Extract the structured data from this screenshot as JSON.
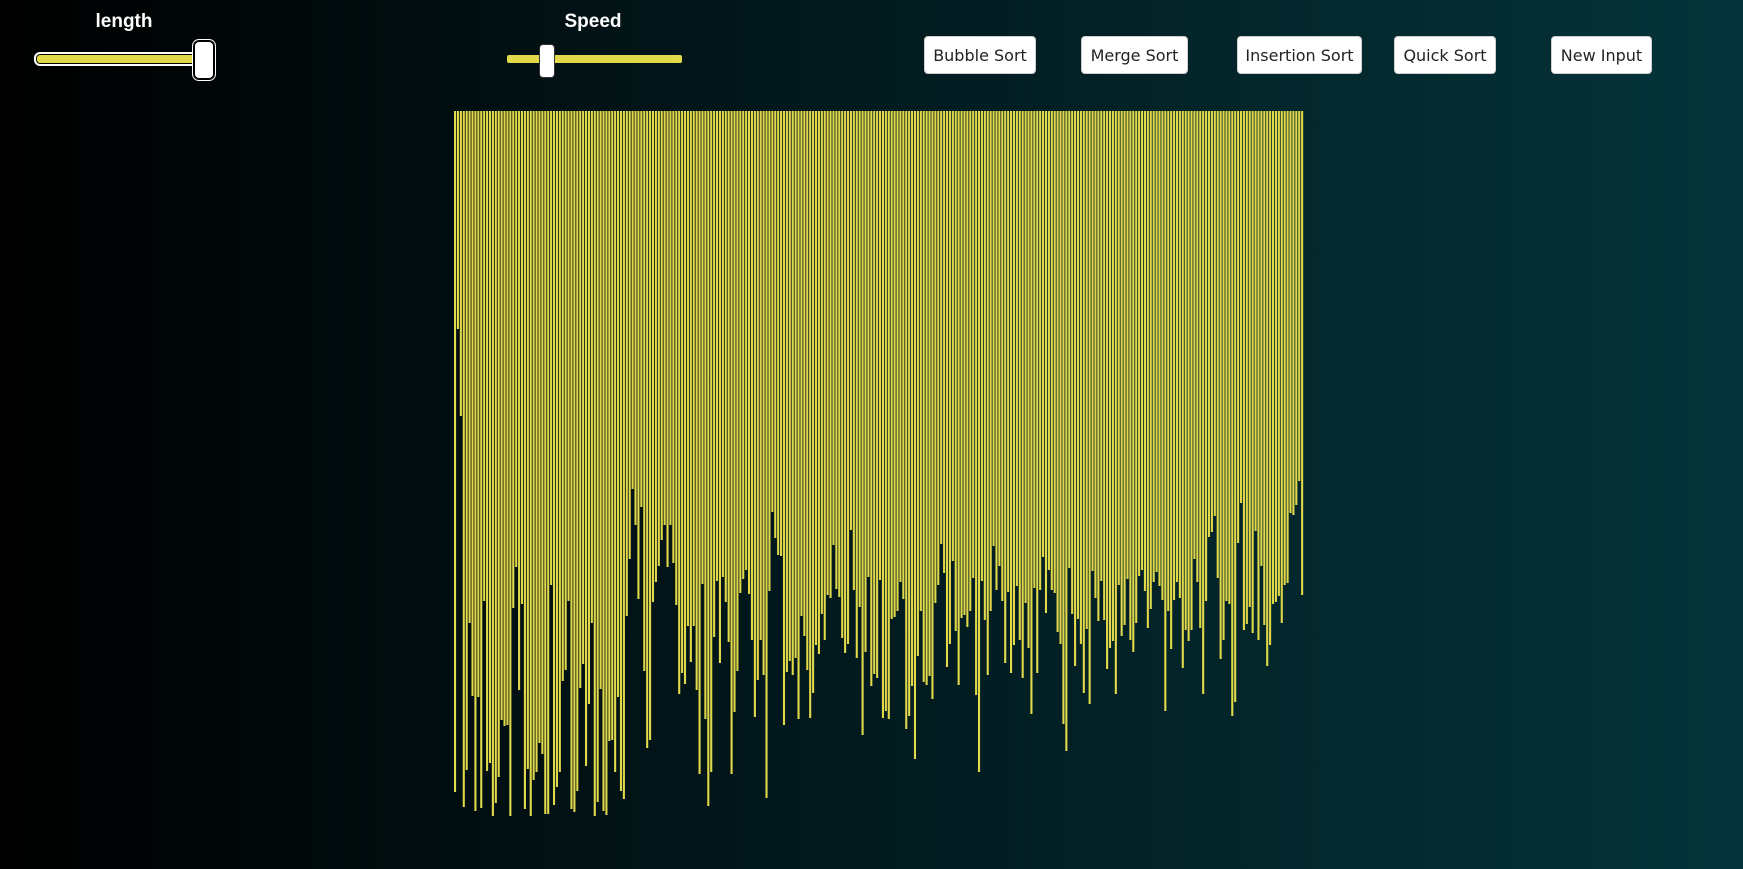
{
  "controls": {
    "length_label": "length",
    "speed_label": "Speed",
    "length_level": 0.95,
    "speed_level": 0.22
  },
  "buttons": {
    "bubble": "Bubble Sort",
    "merge": "Merge Sort",
    "insertion": "Insertion Sort",
    "quick": "Quick Sort",
    "new_input": "New Input"
  },
  "colors": {
    "bar": "#e1d84a",
    "background_start": "#000000",
    "background_end": "#04343a"
  },
  "chart_data": {
    "type": "bar",
    "orientation": "hanging-from-top",
    "ylim": [
      0,
      705
    ],
    "values": [
      681,
      218,
      305,
      696,
      659,
      512,
      585,
      700,
      586,
      697,
      490,
      660,
      652,
      716,
      692,
      666,
      609,
      615,
      614,
      713,
      497,
      456,
      579,
      493,
      698,
      658,
      714,
      669,
      661,
      632,
      643,
      703,
      703,
      474,
      694,
      676,
      661,
      570,
      559,
      490,
      698,
      701,
      680,
      577,
      553,
      655,
      593,
      512,
      712,
      691,
      578,
      700,
      704,
      630,
      629,
      661,
      586,
      680,
      688,
      505,
      448,
      378,
      414,
      488,
      396,
      560,
      637,
      629,
      491,
      471,
      455,
      429,
      414,
      456,
      414,
      452,
      494,
      583,
      562,
      573,
      515,
      551,
      515,
      579,
      663,
      473,
      608,
      695,
      661,
      526,
      470,
      552,
      466,
      491,
      531,
      663,
      601,
      560,
      482,
      468,
      459,
      483,
      529,
      606,
      569,
      529,
      564,
      687,
      480,
      401,
      427,
      444,
      445,
      614,
      561,
      550,
      564,
      547,
      608,
      505,
      525,
      559,
      607,
      582,
      534,
      543,
      503,
      529,
      484,
      487,
      434,
      478,
      486,
      527,
      542,
      533,
      419,
      479,
      547,
      496,
      624,
      541,
      466,
      575,
      563,
      567,
      469,
      607,
      600,
      608,
      508,
      506,
      500,
      471,
      488,
      618,
      605,
      575,
      648,
      545,
      500,
      571,
      574,
      565,
      588,
      492,
      474,
      433,
      462,
      556,
      533,
      450,
      520,
      574,
      507,
      504,
      516,
      500,
      467,
      584,
      661,
      470,
      509,
      564,
      500,
      435,
      479,
      455,
      490,
      552,
      481,
      562,
      534,
      475,
      529,
      567,
      492,
      537,
      603,
      477,
      562,
      479,
      446,
      502,
      459,
      479,
      482,
      521,
      533,
      613,
      640,
      457,
      503,
      555,
      508,
      533,
      582,
      518,
      593,
      460,
      487,
      510,
      470,
      509,
      558,
      537,
      530,
      583,
      474,
      525,
      514,
      468,
      529,
      541,
      512,
      465,
      459,
      480,
      517,
      498,
      471,
      461,
      475,
      489,
      600,
      500,
      538,
      489,
      471,
      487,
      557,
      519,
      530,
      519,
      448,
      471,
      517,
      583,
      490,
      426,
      421,
      405,
      467,
      548,
      529,
      490,
      493,
      605,
      591,
      432,
      392,
      519,
      513,
      496,
      522,
      420,
      529,
      455,
      514,
      555,
      534,
      493,
      491,
      485,
      512,
      474,
      472,
      402,
      404,
      394,
      370,
      484
    ]
  }
}
